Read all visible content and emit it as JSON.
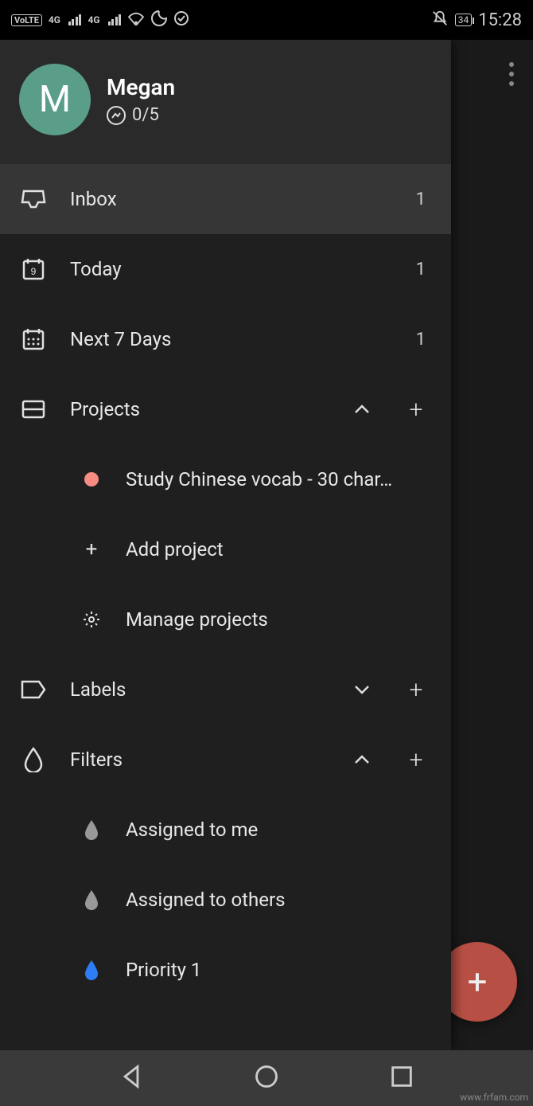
{
  "statusbar": {
    "volte": "VoLTE",
    "sig4g_1": "4G",
    "sig4g_2": "4G",
    "battery": "34",
    "time": "15:28"
  },
  "profile": {
    "initial": "M",
    "name": "Megan",
    "goal": "0/5"
  },
  "nav": {
    "inbox": {
      "label": "Inbox",
      "count": "1"
    },
    "today": {
      "label": "Today",
      "count": "1",
      "date": "9"
    },
    "next7": {
      "label": "Next 7 Days",
      "count": "1"
    },
    "projects": {
      "label": "Projects"
    },
    "labels": {
      "label": "Labels"
    },
    "filters": {
      "label": "Filters"
    }
  },
  "projects": {
    "items": [
      {
        "label": "Study Chinese vocab - 30 char…",
        "color": "#f58b82"
      }
    ],
    "add": "Add project",
    "manage": "Manage projects"
  },
  "filters": {
    "items": [
      {
        "label": "Assigned to me",
        "color": "#999"
      },
      {
        "label": "Assigned to others",
        "color": "#999"
      },
      {
        "label": "Priority 1",
        "color": "#2e7cf6"
      }
    ]
  },
  "watermark": "www.frfam.com"
}
